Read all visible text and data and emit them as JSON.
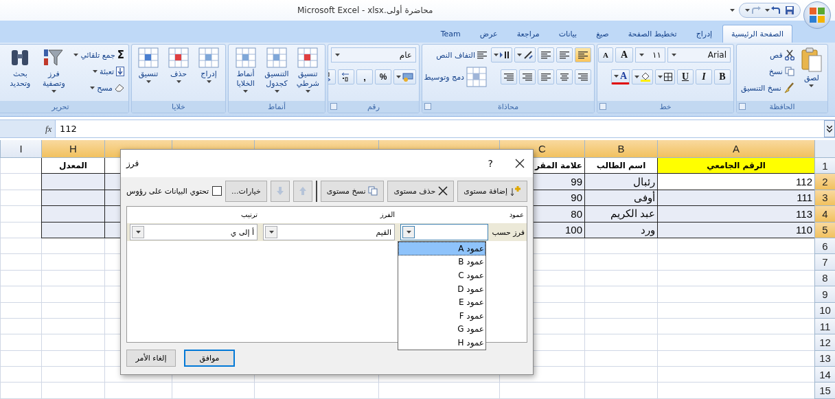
{
  "window": {
    "title": "Microsoft Excel - xlsx.محاضرة أولى"
  },
  "tabs": [
    {
      "label": "الصفحة الرئيسية",
      "selected": true
    },
    {
      "label": "إدراج",
      "selected": false
    },
    {
      "label": "تخطيط الصفحة",
      "selected": false
    },
    {
      "label": "صيغ",
      "selected": false
    },
    {
      "label": "بيانات",
      "selected": false
    },
    {
      "label": "مراجعة",
      "selected": false
    },
    {
      "label": "عرض",
      "selected": false
    },
    {
      "label": "Team",
      "selected": false
    }
  ],
  "ribbon": {
    "clipboard": {
      "title": "الحافظة",
      "paste": "لصق",
      "cut": "قص",
      "copy": "نسخ",
      "format_painter": "نسخ التنسيق"
    },
    "font": {
      "title": "خط",
      "font_name": "Arial",
      "font_size": "١١",
      "grow": "A",
      "shrink": "A",
      "bold": "B",
      "italic": "I",
      "underline": "U",
      "font_color": "A"
    },
    "alignment": {
      "title": "محاذاة",
      "vertical_align": [
        {
          "selected": true
        },
        {
          "selected": false
        },
        {
          "selected": false
        }
      ],
      "wrap_text": "التفاف النص",
      "merge_center": "دمج وتوسيط"
    },
    "number": {
      "title": "رقم",
      "format": "عام",
      "percent": "%",
      "comma": ","
    },
    "styles": {
      "title": "أنماط",
      "buttons": [
        "تنسيق شرطي",
        "التنسيق كجدول",
        "أنماط الخلايا"
      ]
    },
    "cells": {
      "title": "خلايا",
      "buttons": [
        "إدراج",
        "حذف",
        "تنسيق"
      ]
    },
    "editing": {
      "title": "تحرير",
      "autosum_symbol": "Σ",
      "autosum": "جمع تلقائي",
      "fill": "تعبئة",
      "clear": "مسح",
      "sort_filter": "فرز وتصفية",
      "find_select": "بحث وتحديد"
    }
  },
  "formula_bar": {
    "function_symbol": "fx",
    "value": "112"
  },
  "sheet": {
    "columns": [
      {
        "letter": "A",
        "selected": true
      },
      {
        "letter": "B",
        "selected": true
      },
      {
        "letter": "C",
        "selected": true
      },
      {
        "selected": true
      },
      {
        "selected": true
      },
      {
        "selected": true
      },
      {
        "selected": true
      },
      {
        "letter": "H",
        "selected": true
      },
      {
        "letter": "I",
        "selected": false
      }
    ],
    "rows": [
      {
        "number": "1",
        "selected": false,
        "cells": {
          "A": {
            "text": "الرقم الجامعي",
            "color": "#ffff00"
          },
          "B": {
            "text": "اسم الطالب"
          },
          "C": {
            "text": "علامة المقر"
          },
          "H": {
            "text": "المعدل"
          }
        }
      },
      {
        "number": "2",
        "selected": true,
        "cells": {
          "A": {
            "text": "112",
            "active": true
          },
          "B": {
            "text": "رئبال"
          },
          "C": {
            "text": "99"
          }
        }
      },
      {
        "number": "3",
        "selected": true,
        "cells": {
          "A": {
            "text": "111"
          },
          "B": {
            "text": "أوفى"
          },
          "C": {
            "text": "90"
          }
        }
      },
      {
        "number": "4",
        "selected": true,
        "cells": {
          "A": {
            "text": "113"
          },
          "B": {
            "text": "عبد الكريم"
          },
          "C": {
            "text": "80"
          }
        }
      },
      {
        "number": "5",
        "selected": true,
        "cells": {
          "A": {
            "text": "110"
          },
          "B": {
            "text": "ورد"
          },
          "C": {
            "text": "100"
          }
        }
      },
      {
        "number": "6",
        "selected": false
      },
      {
        "number": "7",
        "selected": false
      },
      {
        "number": "8",
        "selected": false
      },
      {
        "number": "9",
        "selected": false
      },
      {
        "number": "10",
        "selected": false
      },
      {
        "number": "11",
        "selected": false
      },
      {
        "number": "12",
        "selected": false
      },
      {
        "number": "13",
        "selected": false
      },
      {
        "number": "14",
        "selected": false
      },
      {
        "number": "15",
        "selected": false
      }
    ]
  },
  "sort_dialog": {
    "title": "فرز",
    "help": "?",
    "toolbar": [
      {
        "kind": "add",
        "label": "إضافة مستوى",
        "disabled": false
      },
      {
        "kind": "delete",
        "label": "حذف مستوى",
        "disabled": false
      },
      {
        "kind": "copy",
        "label": "نسخ مستوى",
        "disabled": false
      },
      {
        "kind": "up",
        "disabled": true
      },
      {
        "kind": "down",
        "disabled": true
      },
      {
        "kind": "options",
        "label": "خيارات...",
        "disabled": false
      }
    ],
    "has_headers": {
      "label": "تحتوي البيانات على رؤوس",
      "checked": false
    },
    "columns": [
      "عمود",
      "الفرز",
      "ترتيب"
    ],
    "levels": [
      {
        "label": "فرز حسب",
        "sort_on": "القيم",
        "order": "أ إلى ي"
      }
    ],
    "dropdown": [
      {
        "label": "عمود A",
        "selected": true
      },
      {
        "label": "عمود B",
        "selected": false
      },
      {
        "label": "عمود C",
        "selected": false
      },
      {
        "label": "عمود D",
        "selected": false
      },
      {
        "label": "عمود E",
        "selected": false
      },
      {
        "label": "عمود F",
        "selected": false
      },
      {
        "label": "عمود G",
        "selected": false
      },
      {
        "label": "عمود H",
        "selected": false
      }
    ],
    "buttons": [
      {
        "label": "موافق",
        "default": true
      },
      {
        "label": "إلغاء الأمر",
        "default": false
      }
    ]
  }
}
